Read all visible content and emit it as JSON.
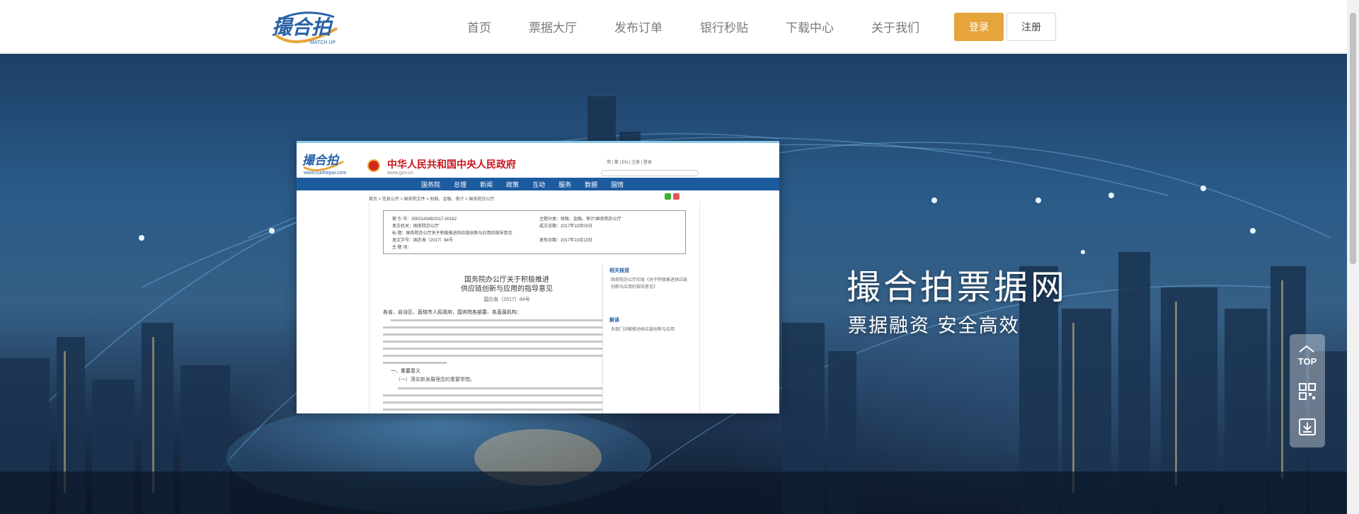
{
  "brand": {
    "logo_text": "撮合拍",
    "logo_sub": "MATCH UP"
  },
  "nav": {
    "items": [
      "首页",
      "票据大厅",
      "发布订单",
      "银行秒贴",
      "下载中心",
      "关于我们"
    ],
    "login_label": "登录",
    "register_label": "注册"
  },
  "hero": {
    "title": "撮合拍票据网",
    "subtitle": "票据融资 安全高效"
  },
  "doc_preview": {
    "logo_text": "撮合拍",
    "logo_url": "www.cuohepai.com",
    "gov_title": "中华人民共和国中央人民政府",
    "gov_site": "www.gov.cn",
    "tools": "简 | 繁 | EN | 注册 | 登录",
    "nav": [
      "国务院",
      "总理",
      "新闻",
      "政策",
      "互动",
      "服务",
      "数据",
      "国情"
    ],
    "breadcrumb": "首页 > 信息公开 > 国务院文件 > 财政、金融、审计 > 国务院办公厅",
    "info": {
      "row1_left": "索 引 号：000014349/2017-00162",
      "row1_right": "主题分类：财政、金融、审计\\国务院办公厅",
      "row2_left": "发文机关：国务院办公厅",
      "row2_right": "成文日期：2017年10月05日",
      "row3_left": "标 题：国务院办公厅关于积极推进供应链创新与应用的指导意见",
      "row4_left": "发文字号：国办发〔2017〕84号",
      "row4_right": "发布日期：2017年10月13日",
      "row5_left": "主 题 词："
    },
    "heading_line1": "国务院办公厅关于积极推进",
    "heading_line2": "供应链创新与应用的指导意见",
    "doc_number": "国办发〔2017〕84号",
    "intro": "各省、自治区、直辖市人民政府，国务院各部委、各直属机构：",
    "section1": "一、重要意义",
    "section1_sub": "（一）落实新发展理念的重要举措。",
    "side_head1": "相关报道",
    "side_text1": "国务院办公厅印发《关于积极推进供应链创新与应用的指导意见》",
    "side_head2": "解读",
    "side_text2": "多部门详解推动供应链创新与应用"
  },
  "side_tools": {
    "top_label": "TOP",
    "icons": [
      "arrow-up-icon",
      "qrcode-icon",
      "download-icon"
    ]
  }
}
